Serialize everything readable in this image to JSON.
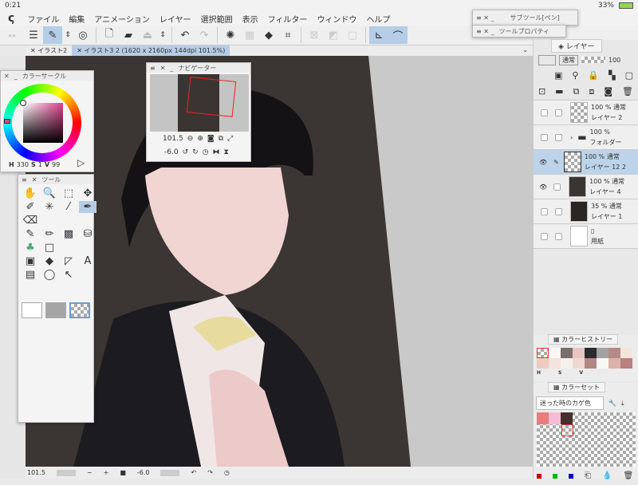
{
  "status": {
    "time": "0:21",
    "battery": "33%"
  },
  "menu": [
    "ファイル",
    "編集",
    "アニメーション",
    "レイヤー",
    "選択範囲",
    "表示",
    "フィルター",
    "ウィンドウ",
    "ヘルプ"
  ],
  "tabs": [
    {
      "label": "イラスト2"
    },
    {
      "label": "イラスト3 2 (1620 x 2160px 144dpi 101.5%)"
    }
  ],
  "floating": {
    "subtool": "サブツール[ペン]",
    "toolprop": "ツールプロパティ"
  },
  "navigator": {
    "title": "ナビゲーター",
    "zoom": "101.5",
    "angle": "-6.0"
  },
  "colorcircle": {
    "title": "カラーサークル",
    "h_label": "H",
    "h": "330",
    "s_label": "S",
    "s": "1",
    "v_label": "V",
    "v": "99",
    "accent": "#e0418c"
  },
  "toolpanel": {
    "title": "ツール"
  },
  "layers": {
    "tab": "レイヤー",
    "blend": "通常",
    "opacity": "100",
    "items": [
      {
        "pct": "100 %",
        "mode": "通常",
        "name": "レイヤー 2"
      },
      {
        "pct": "100 %",
        "mode": "通常",
        "name": "フォルダー"
      },
      {
        "pct": "100 %",
        "mode": "通常",
        "name": "レイヤー 12 2"
      },
      {
        "pct": "100 %",
        "mode": "通常",
        "name": "レイヤー 4"
      },
      {
        "pct": "35 %",
        "mode": "通常",
        "name": "レイヤー 1"
      },
      {
        "pct": "",
        "mode": "",
        "name": "用紙"
      }
    ]
  },
  "history": {
    "tab": "カラーヒストリー",
    "colors": [
      "#f9f7f6",
      "#7a6e6b",
      "#e8c4c2",
      "#2a2b2f",
      "#a2a2a2",
      "#b58a86",
      "#f4e4da",
      "#ebcbc3",
      "#f3e3dc",
      "#f6f0ea",
      "#efd8d2",
      "#b28682",
      "#faf7f7",
      "#ddb1ab",
      "#b8807e"
    ],
    "labels": [
      "H",
      "S",
      "V"
    ]
  },
  "colorset": {
    "tab": "カラーセット",
    "name": "迷った時のカゲ色",
    "colors": [
      "#ea7c7c",
      "#f6bcd6",
      "#44302c"
    ]
  },
  "bottom": {
    "zoom": "101.5",
    "angle": "-6.0"
  }
}
